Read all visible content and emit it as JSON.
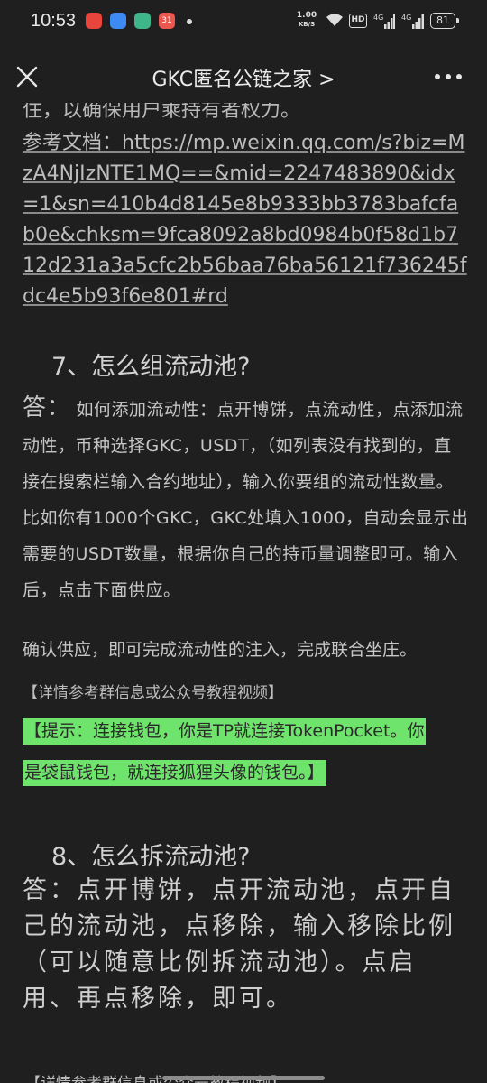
{
  "status_bar": {
    "time": "10:53",
    "speed_value": "1.00",
    "speed_unit": "KB/S",
    "hd": "HD",
    "net1": "4G",
    "net2": "4G",
    "battery": "81",
    "app_badge": "31"
  },
  "nav": {
    "title": "GKC匿名公链之家 >"
  },
  "article": {
    "cut_line": "住，以确保用户乘持有者权力。",
    "ref_label": "参考文档：",
    "ref_url": "https://mp.weixin.qq.com/s?biz=MzA4NjIzNTE1MQ==&mid=2247483890&idx=1&sn=410b4d8145e8b9333bb3783bafcfab0e&chksm=9fca8092a8bd0984b0f58d1b712d231a3a5cfc2b56baa76ba56121f736245fdc4e5b93f6e801#rd",
    "q7_heading": "7、怎么组流动池?",
    "q7_answer_label": "答：",
    "q7_answer": " 如何添加流动性：点开博饼，点流动性，点添加流动性，币种选择GKC，USDT，（如列表没有找到的，直接在搜索栏输入合约地址），输入你要组的流动性数量。比如你有1000个GKC，GKC处填入1000，自动会显示出需要的USDT数量，根据你自己的持币量调整即可。输入后，点击下面供应。",
    "q7_answer_2": "确认供应，即可完成流动性的注入，完成联合坐庄。",
    "q7_note": "【详情参考群信息或公众号教程视频】",
    "tip_line1": "【提示：连接钱包，你是TP就连接TokenPocket。你",
    "tip_line2": "是袋鼠钱包，就连接狐狸头像的钱包。】",
    "q8_heading": "8、怎么拆流动池?",
    "q8_answer": "答：点开博饼，点开流动池，点开自己的流动池，点移除，输入移除比例（可以随意比例拆流动池）。点启用、再点移除，即可。",
    "q8_note": "【详情参考群信息或公众号教程视频】"
  },
  "colors": {
    "background": "#1f1f1f",
    "highlight": "#6fe46c"
  }
}
